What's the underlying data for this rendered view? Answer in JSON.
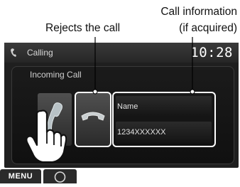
{
  "callouts": {
    "reject": "Rejects the call",
    "info_line1": "Call information",
    "info_line2": "(if acquired)"
  },
  "status_bar": {
    "icon": "phone-handset-icon",
    "title": "Calling",
    "clock": "10:28"
  },
  "call_panel": {
    "title": "Incoming Call",
    "answer_icon": "answer-call-icon",
    "reject_icon": "reject-call-icon",
    "name": "Name",
    "number": "1234XXXXXX"
  },
  "bottom_bar": {
    "menu_label": "MENU",
    "home_icon": "home-circle-icon"
  },
  "pointer_icon": "hand-pointer-icon",
  "colors": {
    "screen_bg": "#1f1f1f",
    "highlight": "#ffffff",
    "text": "#e0e0e0"
  }
}
